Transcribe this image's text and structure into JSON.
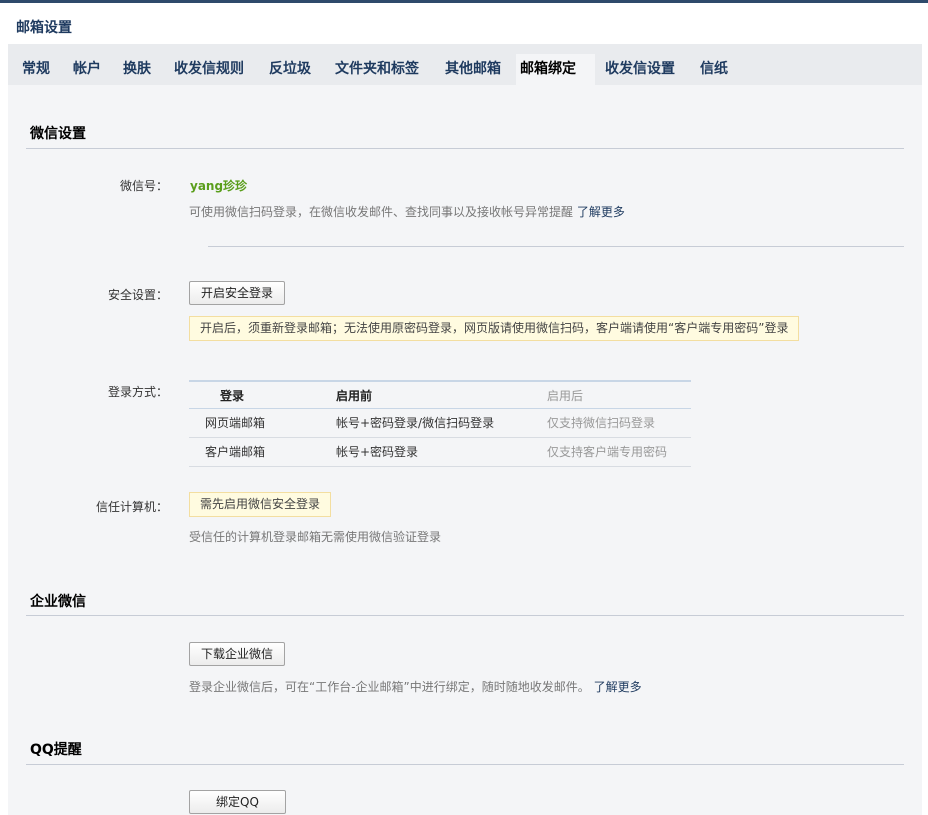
{
  "page": {
    "title": "邮箱设置"
  },
  "tabs": [
    {
      "label": "常规"
    },
    {
      "label": "帐户"
    },
    {
      "label": "换肤"
    },
    {
      "label": "收发信规则"
    },
    {
      "label": "反垃圾"
    },
    {
      "label": "文件夹和标签"
    },
    {
      "label": "其他邮箱"
    },
    {
      "label": "邮箱绑定",
      "active": true
    },
    {
      "label": "收发信设置"
    },
    {
      "label": "信纸"
    }
  ],
  "wechat": {
    "title": "微信设置",
    "id_label": "微信号：",
    "id_value": "yang珍珍",
    "desc": "可使用微信扫码登录，在微信收发邮件、查找同事以及接收帐号异常提醒",
    "learn_more": "了解更多",
    "security_label": "安全设置：",
    "security_button": "开启安全登录",
    "security_notice": "开启后，须重新登录邮箱；无法使用原密码登录，网页版请使用微信扫码，客户端请使用“客户端专用密码”登录",
    "login_label": "登录方式：",
    "table": {
      "headers": [
        "登录",
        "启用前",
        "启用后"
      ],
      "rows": [
        [
          "网页端邮箱",
          "帐号+密码登录/微信扫码登录",
          "仅支持微信扫码登录"
        ],
        [
          "客户端邮箱",
          "帐号+密码登录",
          "仅支持客户端专用密码"
        ]
      ]
    },
    "trusted_label": "信任计算机：",
    "trusted_notice": "需先启用微信安全登录",
    "trusted_desc": "受信任的计算机登录邮箱无需使用微信验证登录"
  },
  "wework": {
    "title": "企业微信",
    "button": "下载企业微信",
    "desc": "登录企业微信后，可在“工作台-企业邮箱”中进行绑定，随时随地收发邮件。",
    "learn_more": "了解更多"
  },
  "qq": {
    "title": "QQ提醒",
    "button": "绑定QQ"
  },
  "colors": {
    "brand": "#1e3a5f",
    "wechat_green": "#5a9e1c",
    "notice_bg": "#fffbe0"
  }
}
